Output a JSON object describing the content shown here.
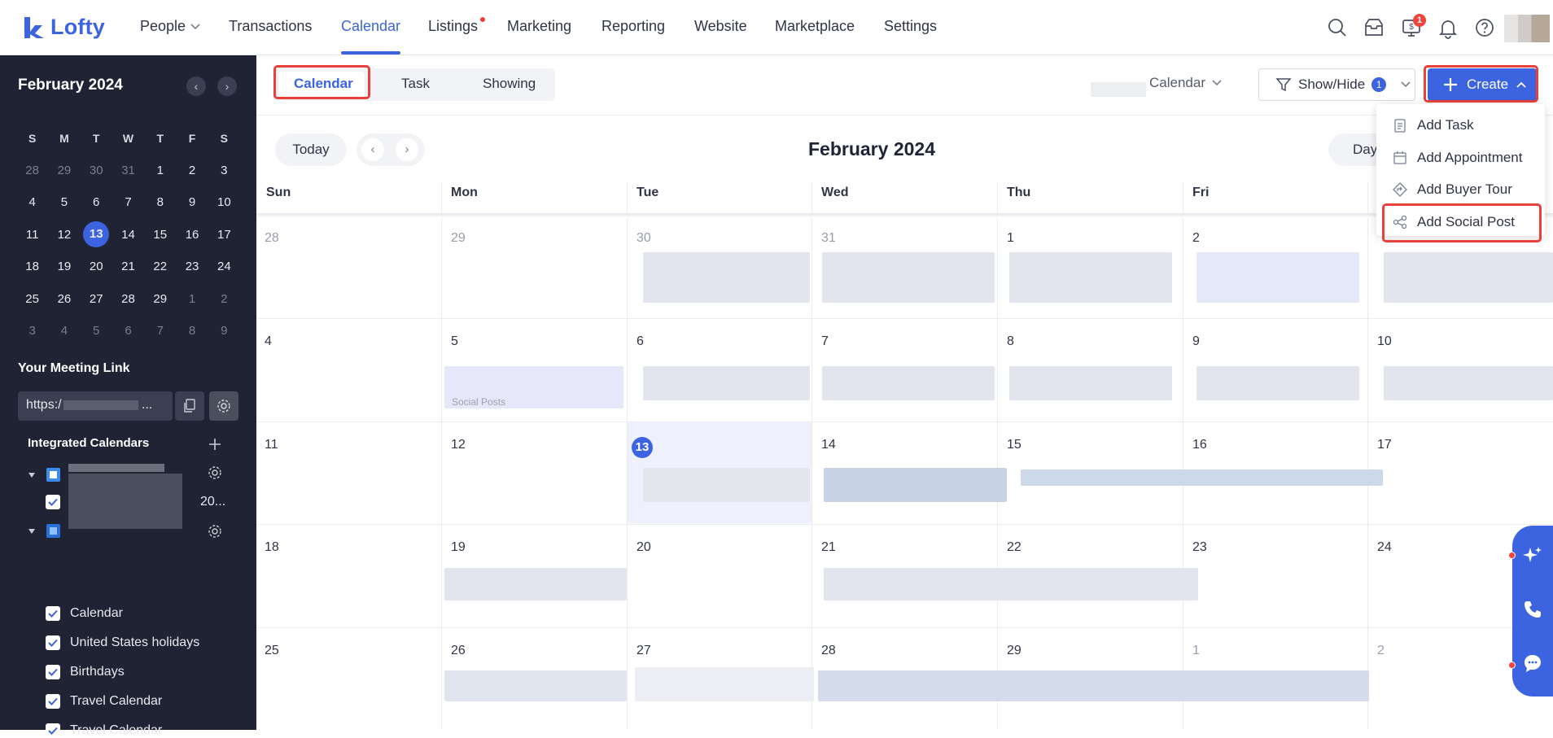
{
  "app": {
    "name": "Lofty"
  },
  "nav": {
    "items": [
      "People",
      "Transactions",
      "Calendar",
      "Listings",
      "Marketing",
      "Reporting",
      "Website",
      "Marketplace",
      "Settings"
    ],
    "active": "Calendar",
    "notification_badge": "1"
  },
  "sidebar": {
    "mini_month": "February 2024",
    "weekdays": [
      "S",
      "M",
      "T",
      "W",
      "T",
      "F",
      "S"
    ],
    "weeks": [
      [
        "28",
        "29",
        "30",
        "31",
        "1",
        "2",
        "3"
      ],
      [
        "4",
        "5",
        "6",
        "7",
        "8",
        "9",
        "10"
      ],
      [
        "11",
        "12",
        "13",
        "14",
        "15",
        "16",
        "17"
      ],
      [
        "18",
        "19",
        "20",
        "21",
        "22",
        "23",
        "24"
      ],
      [
        "25",
        "26",
        "27",
        "28",
        "29",
        "1",
        "2"
      ],
      [
        "3",
        "4",
        "5",
        "6",
        "7",
        "8",
        "9"
      ]
    ],
    "today": "13",
    "meeting_link_title": "Your Meeting Link",
    "meeting_link_prefix": "https:/",
    "meeting_link_ellipsis": "...",
    "integrated_title": "Integrated Calendars",
    "account_suffix": "20...",
    "calendars": [
      "Calendar",
      "United States holidays",
      "Birthdays",
      "Travel Calendar",
      "Travel Calendar"
    ]
  },
  "toolbar": {
    "tabs": [
      "Calendar",
      "Task",
      "Showing"
    ],
    "active_tab": "Calendar",
    "calendar_select": "Calendar",
    "show_hide": "Show/Hide",
    "show_hide_count": "1",
    "create": "Create"
  },
  "calendar": {
    "today_btn": "Today",
    "title": "February 2024",
    "view_btn": "Day",
    "days": [
      "Sun",
      "Mon",
      "Tue",
      "Wed",
      "Thu",
      "Fri"
    ],
    "weeks": [
      [
        "28",
        "29",
        "30",
        "31",
        "1",
        "2",
        ""
      ],
      [
        "4",
        "5",
        "6",
        "7",
        "8",
        "9",
        "10"
      ],
      [
        "11",
        "12",
        "13",
        "14",
        "15",
        "16",
        "17"
      ],
      [
        "18",
        "19",
        "20",
        "21",
        "22",
        "23",
        "24"
      ],
      [
        "25",
        "26",
        "27",
        "28",
        "29",
        "1",
        "2"
      ]
    ],
    "event_label": "Social Posts"
  },
  "create_menu": {
    "items": [
      "Add Task",
      "Add Appointment",
      "Add Buyer Tour",
      "Add Social Post"
    ]
  },
  "colors": {
    "accent": "#3c64e0",
    "highlight": "#e8403a",
    "sidebar_bg": "#1f2334"
  }
}
